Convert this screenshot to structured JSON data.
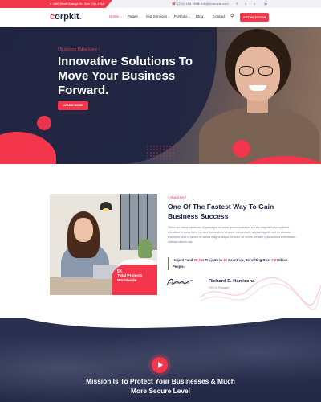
{
  "topbar": {
    "address": "680 West Orange St. Sun City, USA",
    "phone": "(232) 456-7890",
    "email": "info@example.com",
    "social_icons": [
      "facebook-icon",
      "twitter-icon",
      "instagram-icon",
      "linkedin-icon"
    ]
  },
  "header": {
    "logo_c": "c",
    "logo_rest": "orpkit",
    "logo_dot": ".",
    "nav": [
      {
        "label": "Home",
        "has_dropdown": true,
        "active": true
      },
      {
        "label": "Pages",
        "has_dropdown": true,
        "active": false
      },
      {
        "label": "Our Services",
        "has_dropdown": true,
        "active": false
      },
      {
        "label": "Portfolio",
        "has_dropdown": true,
        "active": false
      },
      {
        "label": "Blog",
        "has_dropdown": true,
        "active": false
      },
      {
        "label": "Contact",
        "has_dropdown": false,
        "active": false
      }
    ],
    "cta_label": "GET IN TOUCH"
  },
  "hero": {
    "eyebrow": "\\ Business Make Easy \\",
    "title": "Innovative Solutions To Move Your Business Forward.",
    "button_label": "LEARN MORE",
    "slide_count": 2,
    "active_slide": 1
  },
  "about": {
    "eyebrow": "\\ About Us \\",
    "title": "One Of The Fastest Way To Gain Business Success",
    "body": "There are many variations of passages of lorem ipsum available, but the majority have suffered alteration in some form, by oied ipsum dolor sit amet, consectetur adipisicing elit, sed do eiumod tempoinci dunt ut labore et dolore magna aliqua. Ut enim ad minim veniam, quis nostrud exercitation ullamco laboris nisi.",
    "helped_prefix": "Helped Fund ",
    "helped_amount": "78,743",
    "helped_mid": " Projects in ",
    "helped_countries": "30",
    "helped_mid2": " Countries, Benefiting Over ",
    "helped_people": "7.8",
    "helped_suffix": " Million People.",
    "stat_number": "5K",
    "stat_label": "Total Projects Worldwide",
    "ceo_name": "Richard E. Harrisona",
    "ceo_role": "CEO & Founder"
  },
  "mission": {
    "title": "Mission Is To Protect Your Businesses & Much More Secure Level"
  },
  "colors": {
    "accent": "#f4364c",
    "navy": "#1d2340"
  }
}
